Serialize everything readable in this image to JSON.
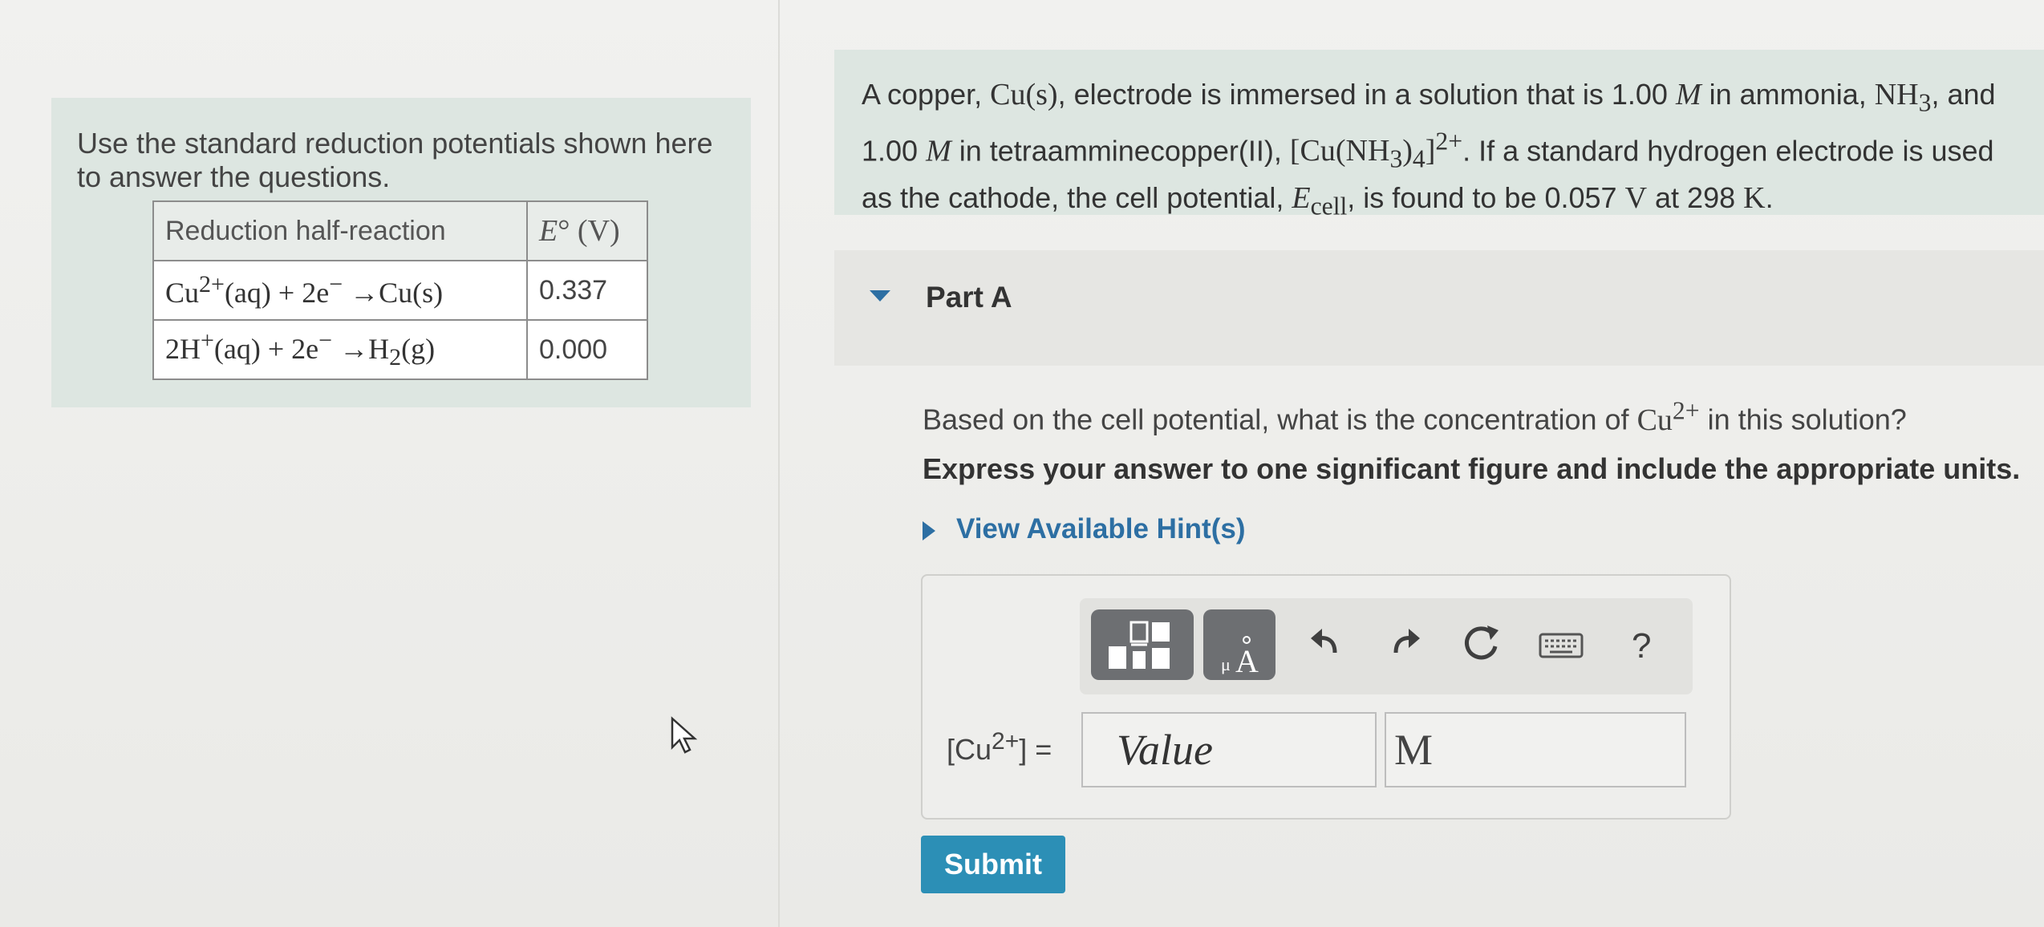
{
  "left": {
    "intro": "Use the standard reduction potentials shown here to answer the questions.",
    "table": {
      "header_reaction": "Reduction half-reaction",
      "header_e": "E° (V)",
      "rows": [
        {
          "reaction_html": "Cu<sup>2+</sup>(aq) + 2e<sup>−</sup> →Cu(s)",
          "value": "0.337"
        },
        {
          "reaction_html": "2H<sup>+</sup>(aq) + 2e<sup>−</sup> →H<sub>2</sub>(g)",
          "value": "0.000"
        }
      ]
    }
  },
  "problem": {
    "text_html": "A copper, <span class=\"math\">Cu(s)</span>, electrode is immersed in a solution that is 1.00 <span class=\"math\"><i>M</i></span> in ammonia, <span class=\"math\">NH<sub>3</sub></span>, and 1.00 <span class=\"math\"><i>M</i></span> in tetraamminecopper(II), <span class=\"math\">[Cu(NH<sub>3</sub>)<sub>4</sub>]<sup>2+</sup></span>. If a standard hydrogen electrode is used as the cathode, the cell potential, <span class=\"math\"><i>E</i><sub>cell</sub></span>, is found to be 0.057 <span class=\"math\">V</span> at 298 <span class=\"math\">K</span>."
  },
  "part": {
    "title": "Part A",
    "question_html": "Based on the cell potential, what is the concentration of <span class=\"math\">Cu<sup>2+</sup></span> in this solution?",
    "instruction": "Express your answer to one significant figure and include the appropriate units.",
    "hint_link": "View Available Hint(s)"
  },
  "answer": {
    "label_html": "[Cu<sup>2+</sup>] =",
    "value_placeholder": "Value",
    "units_value": "M",
    "submit_label": "Submit",
    "toolbar_icons": [
      "templates-icon",
      "units-angstrom-icon",
      "undo-icon",
      "redo-icon",
      "reset-icon",
      "keyboard-icon",
      "help-icon"
    ],
    "help_glyph": "?"
  }
}
